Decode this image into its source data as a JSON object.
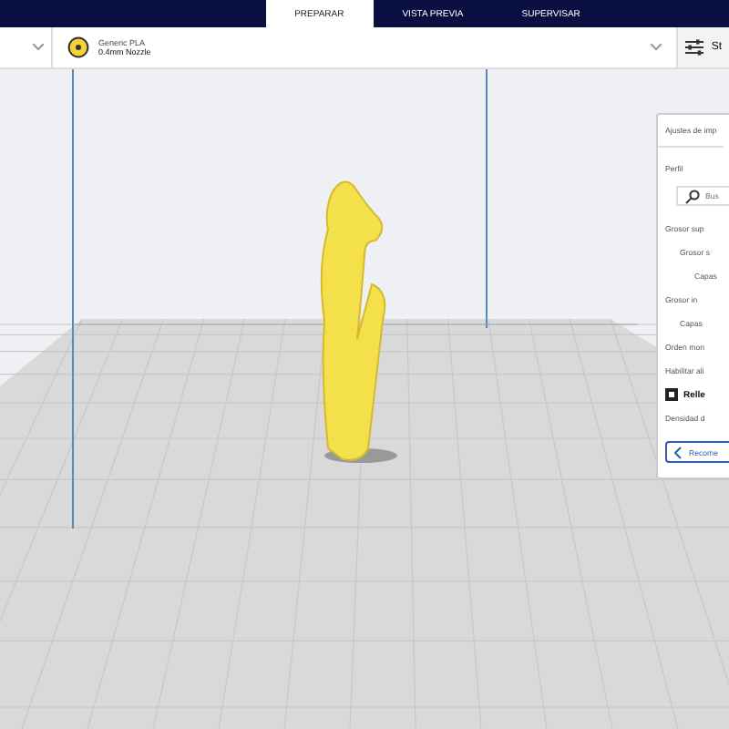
{
  "tabs": [
    {
      "label": "PREPARAR",
      "selected": true
    },
    {
      "label": "VISTA PREVIA",
      "selected": false
    },
    {
      "label": "SUPERVISAR",
      "selected": false
    }
  ],
  "material": {
    "name": "Generic PLA",
    "nozzle": "0.4mm Nozzle"
  },
  "settings_button": {
    "label": "St"
  },
  "panel": {
    "title": "Ajustes de imp",
    "profile_label": "Perfil",
    "search": {
      "placeholder": "Bus"
    },
    "settings": [
      {
        "kind": "setting",
        "label": "Grosor sup",
        "children": [
          {
            "kind": "setting",
            "label": "Grosor s",
            "children": [
              {
                "kind": "setting",
                "label": "Capas"
              }
            ]
          }
        ]
      },
      {
        "kind": "setting",
        "label": "Grosor in",
        "children": [
          {
            "kind": "setting",
            "label": "Capas"
          }
        ]
      },
      {
        "kind": "setting",
        "label": "Orden mon"
      },
      {
        "kind": "setting",
        "label": "Habilitar ali"
      },
      {
        "kind": "category",
        "label": "Relle"
      },
      {
        "kind": "setting",
        "label": "Densidad d"
      }
    ],
    "recommend_button": "Recome"
  }
}
